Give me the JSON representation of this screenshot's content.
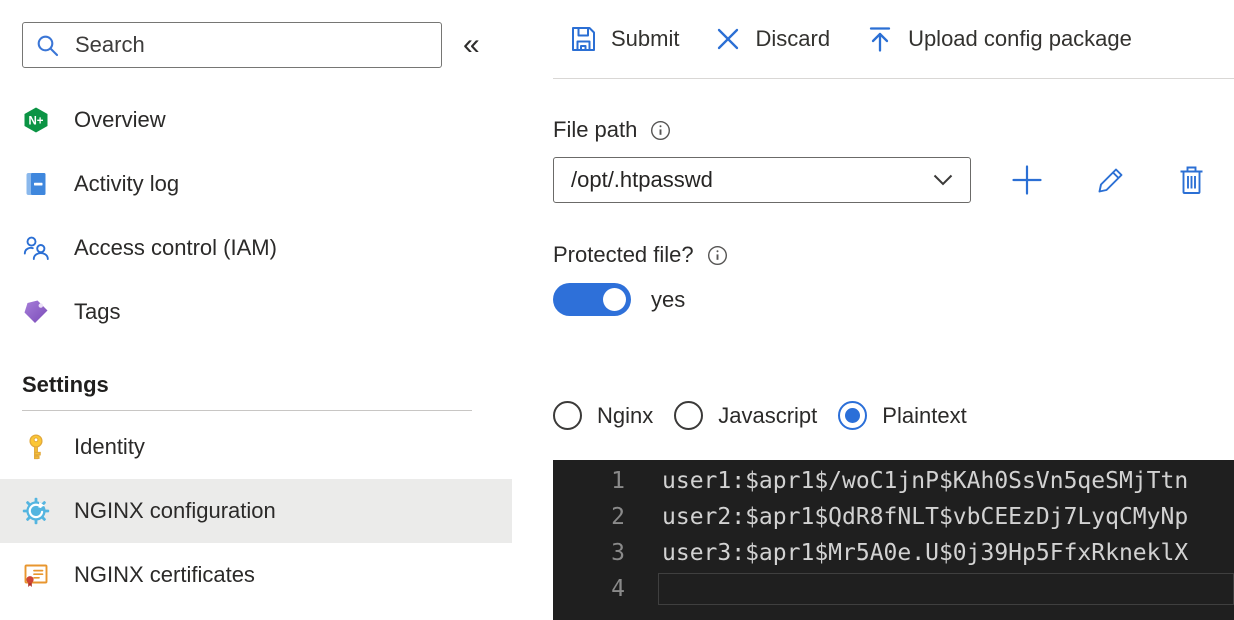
{
  "sidebar": {
    "search_placeholder": "Search",
    "collapse_glyph": "«",
    "items": [
      {
        "label": "Overview",
        "icon": "nginx-plus-icon"
      },
      {
        "label": "Activity log",
        "icon": "activity-log-icon"
      },
      {
        "label": "Access control (IAM)",
        "icon": "people-icon"
      },
      {
        "label": "Tags",
        "icon": "tag-icon"
      }
    ],
    "section_title": "Settings",
    "settings_items": [
      {
        "label": "Identity",
        "icon": "key-icon",
        "selected": false
      },
      {
        "label": "NGINX configuration",
        "icon": "gear-icon",
        "selected": true
      },
      {
        "label": "NGINX certificates",
        "icon": "certificate-icon",
        "selected": false
      }
    ]
  },
  "toolbar": {
    "submit_label": "Submit",
    "discard_label": "Discard",
    "upload_label": "Upload config package"
  },
  "main": {
    "file_path": {
      "label": "File path",
      "value": "/opt/.htpasswd"
    },
    "protected_file": {
      "label": "Protected file?",
      "state": "yes",
      "enabled": true
    },
    "format_options": [
      {
        "label": "Nginx",
        "selected": false
      },
      {
        "label": "Javascript",
        "selected": false
      },
      {
        "label": "Plaintext",
        "selected": true
      }
    ],
    "editor": {
      "lines": [
        {
          "number": "1",
          "text": "user1:$apr1$/woC1jnP$KAh0SsVn5qeSMjTtn"
        },
        {
          "number": "2",
          "text": "user2:$apr1$QdR8fNLT$vbCEEzDj7LyqCMyNp"
        },
        {
          "number": "3",
          "text": "user3:$apr1$Mr5A0e.U$0j39Hp5FfxRkneklX"
        },
        {
          "number": "4",
          "text": ""
        }
      ]
    }
  },
  "colors": {
    "accent_blue": "#2b6fd4",
    "toggle_blue": "#2e70d9",
    "gear_light_blue": "#54b5e0",
    "nginx_green": "#0b9444",
    "tag_purple": "#8a5fc0",
    "key_yellow": "#fcc734",
    "certificate_orange": "#e8962e",
    "selected_item_bg": "#ebebea",
    "editor_bg": "#1f1f1f",
    "editor_text": "#d2d2d2",
    "editor_line_number": "#8a8a8a"
  }
}
